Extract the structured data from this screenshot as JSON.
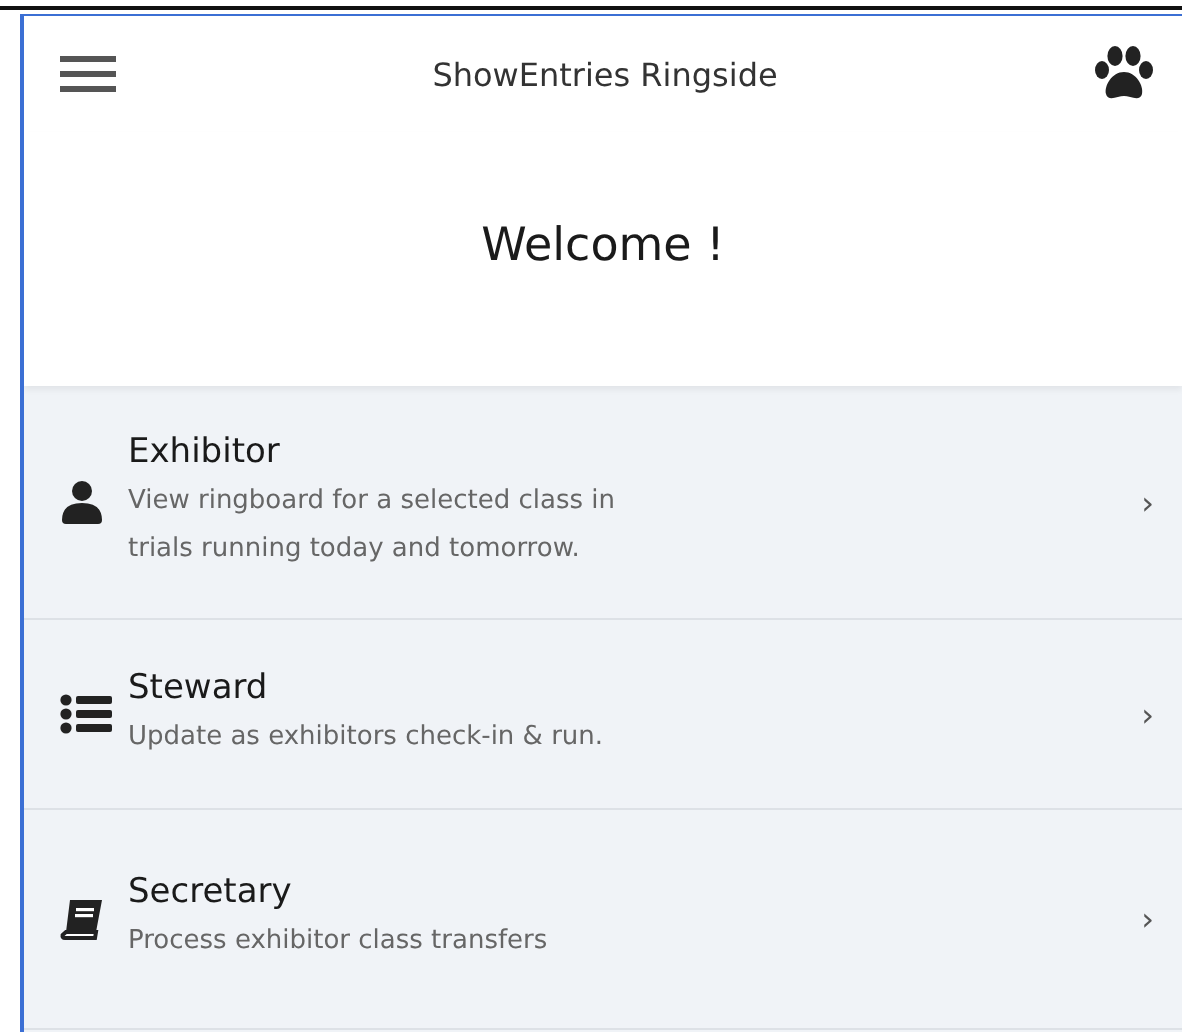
{
  "header": {
    "title": "ShowEntries Ringside"
  },
  "welcome": "Welcome !",
  "menu": [
    {
      "kind": "person",
      "title": "Exhibitor",
      "description": "View ringboard for a selected class in trials running today and tomorrow.",
      "chevron": "›"
    },
    {
      "kind": "list",
      "title": "Steward",
      "description": "Update as exhibitors check-in & run.",
      "chevron": "›"
    },
    {
      "kind": "book",
      "title": "Secretary",
      "description": "Process exhibitor class transfers",
      "chevron": "›"
    }
  ]
}
